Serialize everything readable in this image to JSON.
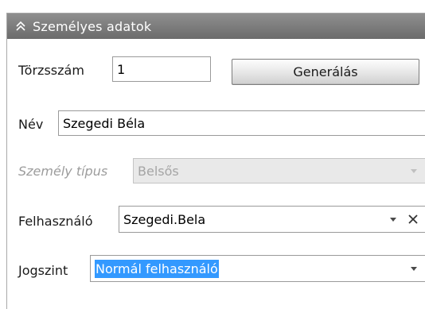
{
  "panel": {
    "title": "Személyes adatok",
    "header_bg": "#7a7a7a"
  },
  "fields": {
    "torzsszam": {
      "label": "Törzsszám",
      "value": "1"
    },
    "generate_button": {
      "label": "Generálás"
    },
    "nev": {
      "label": "Név",
      "value": "Szegedi Béla"
    },
    "szemely_tipus": {
      "label": "Személy típus",
      "value": "Belsős",
      "disabled": true
    },
    "felhasznalo": {
      "label": "Felhasználó",
      "value": "Szegedi.Bela"
    },
    "jogszint": {
      "label": "Jogszint",
      "value": "Normál felhasználó"
    }
  },
  "colors": {
    "selection": "#3399ff",
    "disabled_text": "#9c9c9c",
    "border": "#9a9a9a"
  }
}
